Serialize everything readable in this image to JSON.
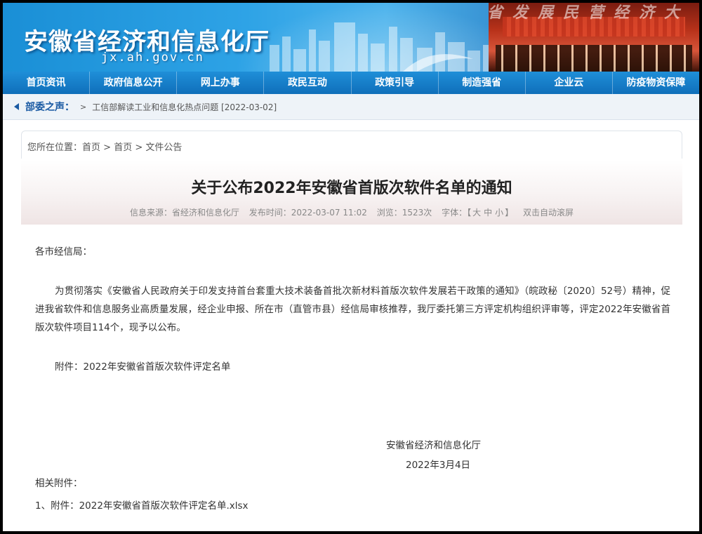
{
  "banner": {
    "site_title": "安徽省经济和信息化厅",
    "site_domain": "jx.ah.gov.cn",
    "slogan": "省发展民营经济大"
  },
  "nav": {
    "items": [
      "首页资讯",
      "政府信息公开",
      "网上办事",
      "政民互动",
      "政策引导",
      "制造强省",
      "企业云",
      "防疫物资保障"
    ]
  },
  "ticker": {
    "label": "部委之声：",
    "arrow": ">",
    "text": "工信部解读工业和信息化热点问题 [2022-03-02]"
  },
  "breadcrumb": {
    "prefix": "您所在位置：",
    "items": [
      "首页",
      "首页",
      "文件公告"
    ],
    "separator": " > "
  },
  "article": {
    "title": "关于公布2022年安徽省首版次软件名单的通知",
    "meta": {
      "source": "信息来源：省经济和信息化厅",
      "time": "发布时间：2022-03-07 11:02",
      "views": "浏览：1523次",
      "font_label": "字体：【",
      "font_large": "大",
      "font_medium": "中",
      "font_small": "小",
      "font_end": "】",
      "autoscroll": "双击自动滚屏"
    },
    "salutation": "各市经信局：",
    "body": "为贯彻落实《安徽省人民政府关于印发支持首台套重大技术装备首批次新材料首版次软件发展若干政策的通知》（皖政秘〔2020〕52号）精神，促进我省软件和信息服务业高质量发展，经企业申报、所在市（直管市县）经信局审核推荐，我厅委托第三方评定机构组织评审等，评定2022年安徽省首版次软件项目114个，现予以公布。",
    "attachment_note": "附件：2022年安徽省首版次软件评定名单",
    "signature_org": "安徽省经济和信息化厅",
    "signature_date": "2022年3月4日",
    "related_label": "相关附件：",
    "related_file": "1、附件：2022年安徽省首版次软件评定名单.xlsx"
  }
}
